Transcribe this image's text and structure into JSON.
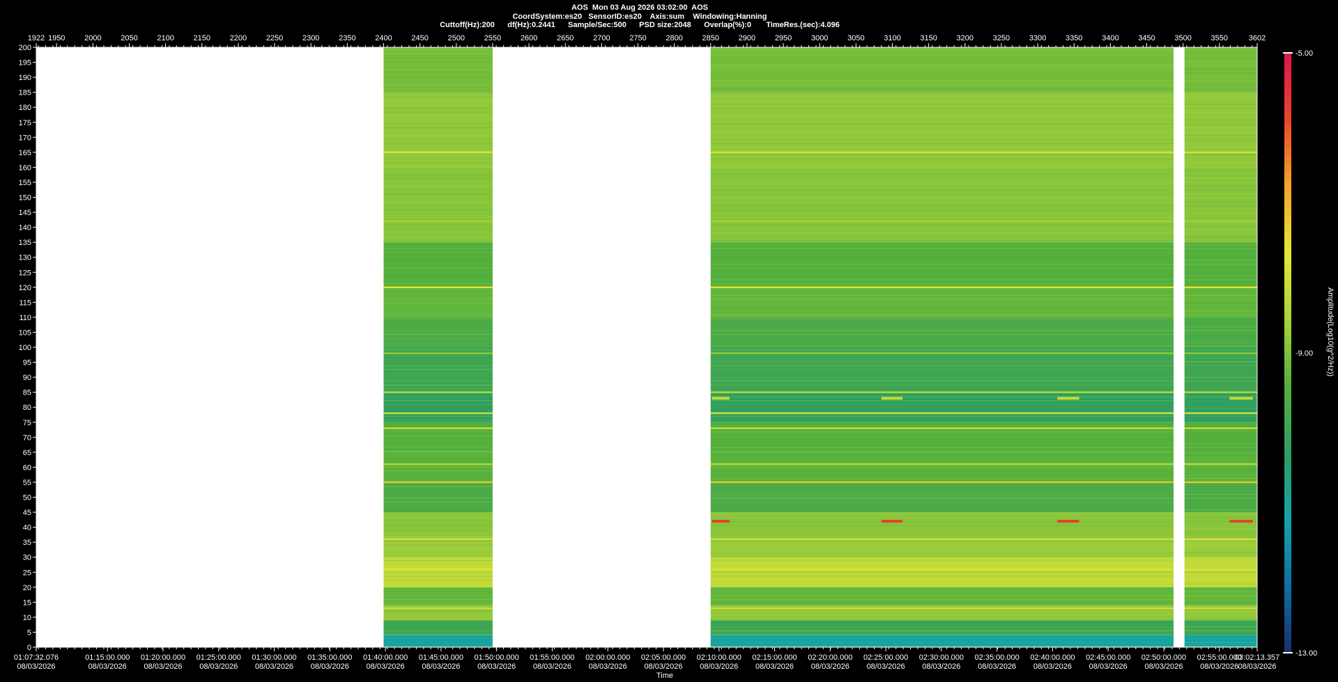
{
  "header": {
    "line1": "AOS  Mon 03 Aug 2026 03:02:00  AOS",
    "line2": "CoordSystem:es20   SensorID:es20    Axis:sum    Windowing:Hanning",
    "line3": "Cuttoff(Hz):200      df(Hz):0.2441      Sample/Sec:500      PSD size:2048      Overlap(%):0       TimeRes.(sec):4.096"
  },
  "colors": {
    "background": "#000000",
    "gap": "#ffffff",
    "scale": [
      "#1a2f6e",
      "#0f6fa3",
      "#13a3a8",
      "#2e9e62",
      "#55b03c",
      "#a8d23a",
      "#e8e635",
      "#f2a52b",
      "#e8462a",
      "#e0134f"
    ]
  },
  "chart_data": {
    "type": "heatmap",
    "title": "",
    "xlabel": "Time",
    "ylabel": "",
    "colorbar_label": "Amplitude(Log10(g^2/Hz))",
    "colorbar_ticks": [
      "-5.00",
      "-9.00",
      "-13.00"
    ],
    "colorbar_range": [
      -13,
      -5
    ],
    "xlim": [
      1922,
      3602
    ],
    "ylim": [
      0,
      200
    ],
    "top_axis_ticks": [
      "1922",
      "1950",
      "2000",
      "2050",
      "2100",
      "2150",
      "2200",
      "2250",
      "2300",
      "2350",
      "2400",
      "2450",
      "2500",
      "2550",
      "2600",
      "2650",
      "2700",
      "2750",
      "2800",
      "2850",
      "2900",
      "2950",
      "3000",
      "3050",
      "3100",
      "3150",
      "3200",
      "3250",
      "3300",
      "3350",
      "3400",
      "3450",
      "3500",
      "3550",
      "3602"
    ],
    "y_ticks": [
      "0",
      "5",
      "10",
      "15",
      "20",
      "25",
      "30",
      "35",
      "40",
      "45",
      "50",
      "55",
      "60",
      "65",
      "70",
      "75",
      "80",
      "85",
      "90",
      "95",
      "100",
      "105",
      "110",
      "115",
      "120",
      "125",
      "130",
      "135",
      "140",
      "145",
      "150",
      "155",
      "160",
      "165",
      "170",
      "175",
      "180",
      "185",
      "190",
      "195",
      "200"
    ],
    "time_ticks": [
      "01:07:32.076",
      "01:15:00.000",
      "01:20:00.000",
      "01:25:00.000",
      "01:30:00.000",
      "01:35:00.000",
      "01:40:00.000",
      "01:45:00.000",
      "01:50:00.000",
      "01:55:00.000",
      "02:00:00.000",
      "02:05:00.000",
      "02:10:00.000",
      "02:15:00.000",
      "02:20:00.000",
      "02:25:00.000",
      "02:30:00.000",
      "02:35:00.000",
      "02:40:00.000",
      "02:45:00.000",
      "02:50:00.000",
      "02:55:00.000",
      "03:02:13.357"
    ],
    "time_tick_date": "08/03/2026",
    "data_segments": [
      {
        "x_start": 2400,
        "x_end": 2550
      },
      {
        "x_start": 2850,
        "x_end": 3487
      },
      {
        "x_start": 3502,
        "x_end": 3602
      }
    ],
    "frequency_bands_hz": [
      {
        "from": 0,
        "to": 4,
        "level": -11.2
      },
      {
        "from": 4,
        "to": 9,
        "level": -10.0
      },
      {
        "from": 9,
        "to": 14,
        "level": -8.8
      },
      {
        "from": 14,
        "to": 20,
        "level": -9.3
      },
      {
        "from": 20,
        "to": 30,
        "level": -8.2
      },
      {
        "from": 30,
        "to": 37,
        "level": -8.7
      },
      {
        "from": 37,
        "to": 45,
        "level": -8.9
      },
      {
        "from": 45,
        "to": 55,
        "level": -9.7
      },
      {
        "from": 55,
        "to": 65,
        "level": -9.4
      },
      {
        "from": 65,
        "to": 75,
        "level": -9.5
      },
      {
        "from": 75,
        "to": 85,
        "level": -10.3
      },
      {
        "from": 85,
        "to": 100,
        "level": -10.0
      },
      {
        "from": 100,
        "to": 110,
        "level": -9.7
      },
      {
        "from": 110,
        "to": 120,
        "level": -9.3
      },
      {
        "from": 120,
        "to": 135,
        "level": -9.5
      },
      {
        "from": 135,
        "to": 160,
        "level": -8.9
      },
      {
        "from": 160,
        "to": 185,
        "level": -8.8
      },
      {
        "from": 185,
        "to": 200,
        "level": -9.1
      }
    ],
    "tonal_lines_hz": [
      {
        "freq": 85,
        "level": -8.3
      },
      {
        "freq": 78,
        "level": -8.1
      },
      {
        "freq": 73,
        "level": -8.1
      },
      {
        "freq": 61,
        "level": -8.4
      },
      {
        "freq": 55,
        "level": -7.2
      },
      {
        "freq": 120,
        "level": -7.6
      },
      {
        "freq": 165,
        "level": -7.9
      },
      {
        "freq": 142,
        "level": -8.6
      },
      {
        "freq": 98,
        "level": -8.8
      },
      {
        "freq": 36,
        "level": -8.0
      },
      {
        "freq": 26,
        "level": -7.8
      },
      {
        "freq": 13,
        "level": -8.0
      }
    ],
    "intermittent_events": [
      {
        "x_start": 2852,
        "x_end": 2876,
        "freq": 42,
        "level": -5.8
      },
      {
        "x_start": 3085,
        "x_end": 3114,
        "freq": 42,
        "level": -5.8
      },
      {
        "x_start": 3327,
        "x_end": 3357,
        "freq": 42,
        "level": -5.8
      },
      {
        "x_start": 3564,
        "x_end": 3596,
        "freq": 42,
        "level": -5.8
      },
      {
        "x_start": 2852,
        "x_end": 2876,
        "freq": 83,
        "level": -8.2
      },
      {
        "x_start": 3085,
        "x_end": 3114,
        "freq": 83,
        "level": -8.2
      },
      {
        "x_start": 3327,
        "x_end": 3357,
        "freq": 83,
        "level": -8.2
      },
      {
        "x_start": 3564,
        "x_end": 3596,
        "freq": 83,
        "level": -8.2
      }
    ]
  }
}
